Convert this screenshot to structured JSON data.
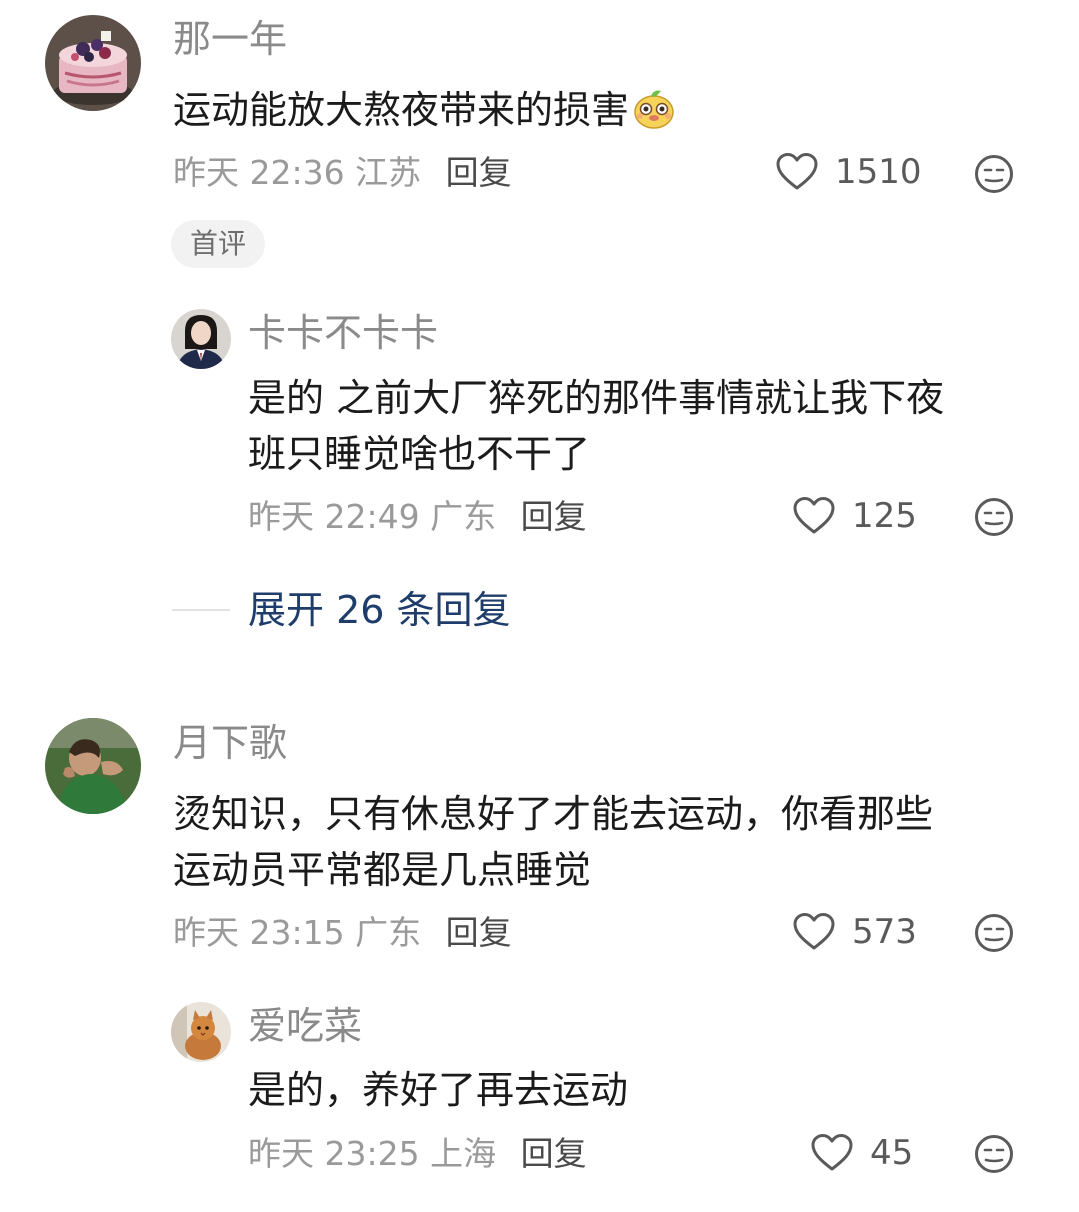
{
  "comments": [
    {
      "user": "那一年",
      "text": "运动能放大熬夜带来的损害",
      "emoji": "mango-face-emoji",
      "time": "昨天 22:36",
      "location": "江苏",
      "reply_label": "回复",
      "likes": "1510",
      "badge": "首评",
      "replies": [
        {
          "user": "卡卡不卡卡",
          "text_lines": [
            "是的 之前大厂猝死的那件事情就让我下夜",
            "班只睡觉啥也不干了"
          ],
          "time": "昨天 22:49",
          "location": "广东",
          "reply_label": "回复",
          "likes": "125"
        }
      ],
      "expand_label": "展开 26 条回复"
    },
    {
      "user": "月下歌",
      "text_lines": [
        "烫知识，只有休息好了才能去运动，你看那些",
        "运动员平常都是几点睡觉"
      ],
      "time": "昨天 23:15",
      "location": "广东",
      "reply_label": "回复",
      "likes": "573",
      "replies": [
        {
          "user": "爱吃菜",
          "text_lines": [
            "是的，养好了再去运动"
          ],
          "time": "昨天 23:25",
          "location": "上海",
          "reply_label": "回复",
          "likes": "45"
        }
      ]
    }
  ],
  "colors": {
    "username": "#8a8a8a",
    "body_text": "#1b1b1b",
    "meta": "#9a9a9a",
    "expand_link": "#1f3d6b"
  },
  "icons": {
    "like": "heart-outline-icon",
    "reaction": "neutral-face-icon"
  }
}
